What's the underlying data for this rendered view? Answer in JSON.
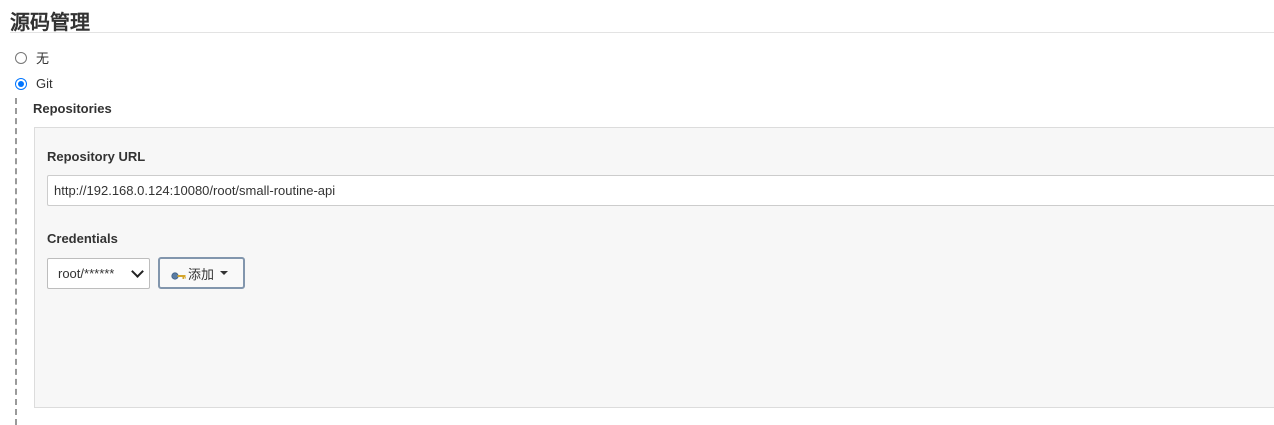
{
  "section": {
    "title": "源码管理"
  },
  "scm_options": [
    {
      "label": "无",
      "checked": false
    },
    {
      "label": "Git",
      "checked": true
    }
  ],
  "repositories": {
    "label": "Repositories",
    "url_label": "Repository URL",
    "url_value": "http://192.168.0.124:10080/root/small-routine-api",
    "credentials_label": "Credentials",
    "credentials_selected": "root/******",
    "add_button_label": "添加",
    "add_button_icon": "key-icon"
  },
  "colors": {
    "radio_accent": "#0075ff",
    "button_border": "#8296ad",
    "panel_bg": "#f7f7f7"
  }
}
